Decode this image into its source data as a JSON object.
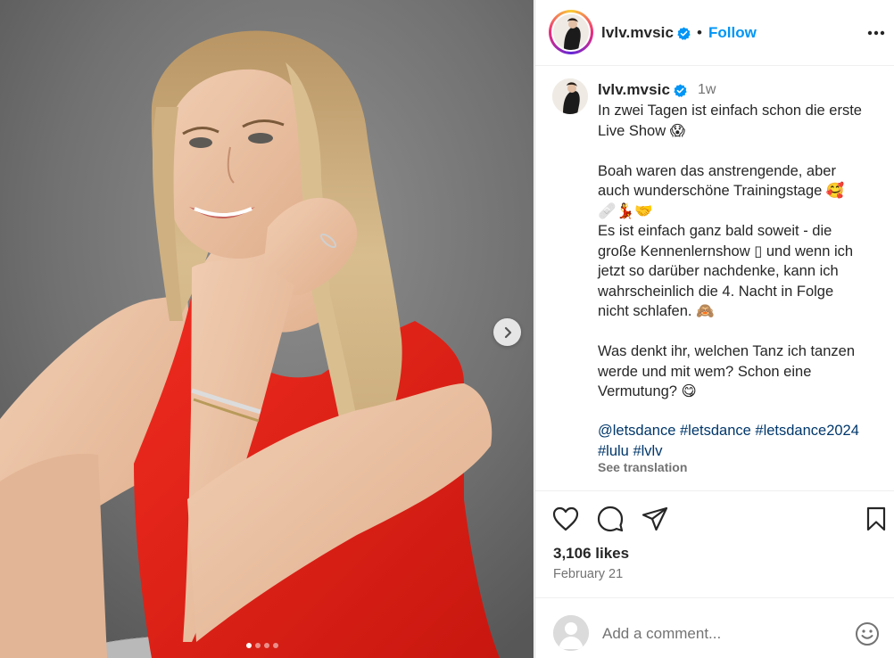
{
  "post": {
    "username": "lvlv.mvsic",
    "follow_label": "Follow",
    "header_separator": "•",
    "time_ago": "1w",
    "caption_lines": [
      "In zwei Tagen ist einfach schon die erste",
      "Live Show 😱",
      "",
      "Boah waren das anstrengende, aber",
      "auch wunderschöne Trainingstage 🥰",
      "🩹💃🤝",
      "Es ist einfach ganz bald soweit - die",
      "große Kennenlernshow ▯ und wenn ich",
      "jetzt so darüber nachdenke, kann ich",
      "wahrscheinlich die 4. Nacht in Folge",
      "nicht schlafen. 🙈",
      "",
      "Was denkt ihr, welchen Tanz ich tanzen",
      "werde und mit wem? Schon eine",
      "Vermutung? 😋"
    ],
    "tags_line1": [
      "@letsdance",
      "#letsdance",
      "#letsdance2024"
    ],
    "tags_line2": [
      "#lulu",
      "#lvlv"
    ],
    "see_translation": "See translation",
    "likes": "3,106 likes",
    "date": "February 21",
    "comment_placeholder": "Add a comment..."
  },
  "carousel": {
    "total_slides": 4,
    "active_slide": 1
  },
  "icons": {
    "verified": "verified-badge-icon",
    "more": "more-options-icon",
    "next": "chevron-right-icon",
    "like": "heart-icon",
    "comment": "comment-bubble-icon",
    "share": "paper-plane-icon",
    "save": "bookmark-icon",
    "emoji": "smiley-icon"
  },
  "colors": {
    "link_blue": "#0095f6",
    "hashtag": "#00376b",
    "muted": "#737373",
    "dress_red": "#e8261d"
  }
}
